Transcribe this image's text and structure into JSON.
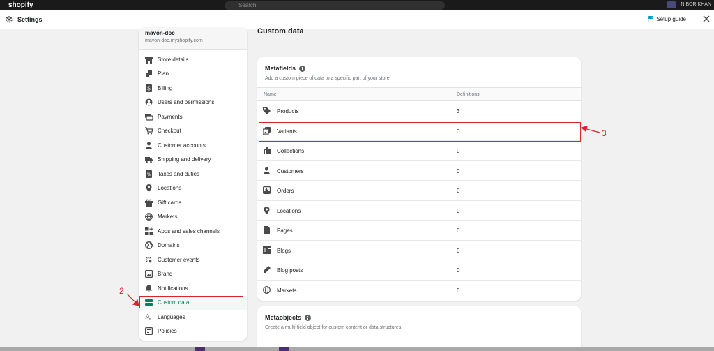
{
  "topbar": {
    "logo_text": "shopify",
    "search_placeholder": "Search",
    "user_initials": "NK",
    "user_name": "NIBOR KHAN"
  },
  "header": {
    "icon": "gear-icon",
    "title": "Settings",
    "setup_guide": "Setup guide",
    "close_icon": "close-icon"
  },
  "sidebar": {
    "store_name": "mavon-doc",
    "store_url": "mavon-doc.myshopify.com",
    "items": [
      {
        "label": "Store details",
        "icon": "store-icon"
      },
      {
        "label": "Plan",
        "icon": "plan-icon"
      },
      {
        "label": "Billing",
        "icon": "billing-icon"
      },
      {
        "label": "Users and permissions",
        "icon": "user-circle-icon"
      },
      {
        "label": "Payments",
        "icon": "payments-icon"
      },
      {
        "label": "Checkout",
        "icon": "cart-icon"
      },
      {
        "label": "Customer accounts",
        "icon": "person-icon"
      },
      {
        "label": "Shipping and delivery",
        "icon": "truck-icon"
      },
      {
        "label": "Taxes and duties",
        "icon": "tax-icon"
      },
      {
        "label": "Locations",
        "icon": "location-icon"
      },
      {
        "label": "Gift cards",
        "icon": "gift-icon"
      },
      {
        "label": "Markets",
        "icon": "globe-icon"
      },
      {
        "label": "Apps and sales channels",
        "icon": "apps-icon"
      },
      {
        "label": "Domains",
        "icon": "domains-icon"
      },
      {
        "label": "Customer events",
        "icon": "events-icon"
      },
      {
        "label": "Brand",
        "icon": "brand-icon"
      },
      {
        "label": "Notifications",
        "icon": "bell-icon"
      },
      {
        "label": "Custom data",
        "icon": "custom-data-icon",
        "active": true
      },
      {
        "label": "Languages",
        "icon": "languages-icon"
      },
      {
        "label": "Policies",
        "icon": "policies-icon"
      }
    ]
  },
  "main": {
    "page_title": "Custom data",
    "metafields": {
      "title": "Metafields",
      "subtitle": "Add a custom piece of data to a specific part of your store.",
      "col_name": "Name",
      "col_definitions": "Definitions",
      "rows": [
        {
          "name": "Products",
          "count": "3",
          "icon": "tag-icon"
        },
        {
          "name": "Variants",
          "count": "0",
          "icon": "variants-icon"
        },
        {
          "name": "Collections",
          "count": "0",
          "icon": "collections-icon"
        },
        {
          "name": "Customers",
          "count": "0",
          "icon": "person-icon"
        },
        {
          "name": "Orders",
          "count": "0",
          "icon": "orders-icon"
        },
        {
          "name": "Locations",
          "count": "0",
          "icon": "location-icon"
        },
        {
          "name": "Pages",
          "count": "0",
          "icon": "page-icon"
        },
        {
          "name": "Blogs",
          "count": "0",
          "icon": "blog-icon"
        },
        {
          "name": "Blog posts",
          "count": "0",
          "icon": "pen-icon"
        },
        {
          "name": "Markets",
          "count": "0",
          "icon": "globe-icon"
        }
      ]
    },
    "metaobjects": {
      "title": "Metaobjects",
      "subtitle": "Create a multi-field object for custom content or data structures."
    }
  },
  "annotations": {
    "step2": "2",
    "step3": "3",
    "color": "#d9232d"
  },
  "colors": {
    "accent": "#008060",
    "annotation": "#d9232d"
  }
}
